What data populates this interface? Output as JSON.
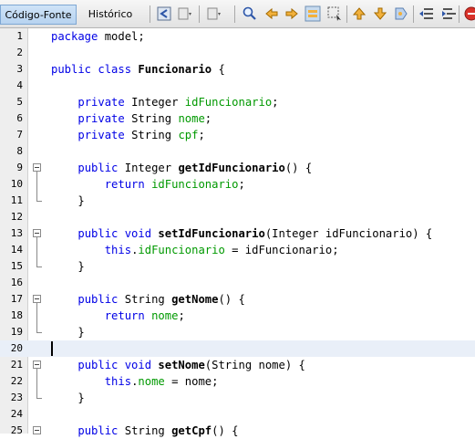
{
  "tabs": [
    {
      "label": "Código-Fonte",
      "active": true
    },
    {
      "label": "Histórico",
      "active": false
    }
  ],
  "toolbar_icons": [
    "back-history-icon",
    "last-edit-icon",
    "forward-edit-icon",
    "search-icon",
    "find-previous-icon",
    "find-next-icon",
    "toggle-highlight-icon",
    "find-selection-icon",
    "prev-bookmark-icon",
    "next-bookmark-icon",
    "toggle-bookmark-icon",
    "shift-left-icon",
    "shift-right-icon",
    "stop-macro-icon"
  ],
  "lines": [
    {
      "n": "1",
      "t": [
        [
          "kw",
          "package"
        ],
        [
          "p",
          " model;"
        ]
      ]
    },
    {
      "n": "2",
      "t": []
    },
    {
      "n": "3",
      "t": [
        [
          "kw",
          "public class"
        ],
        [
          "p",
          " "
        ],
        [
          "cls",
          "Funcionario"
        ],
        [
          "p",
          " {"
        ]
      ]
    },
    {
      "n": "4",
      "t": []
    },
    {
      "n": "5",
      "t": [
        [
          "p",
          "    "
        ],
        [
          "kw",
          "private"
        ],
        [
          "p",
          " Integer "
        ],
        [
          "fld",
          "idFuncionario"
        ],
        [
          "p",
          ";"
        ]
      ]
    },
    {
      "n": "6",
      "t": [
        [
          "p",
          "    "
        ],
        [
          "kw",
          "private"
        ],
        [
          "p",
          " String "
        ],
        [
          "fld",
          "nome"
        ],
        [
          "p",
          ";"
        ]
      ]
    },
    {
      "n": "7",
      "t": [
        [
          "p",
          "    "
        ],
        [
          "kw",
          "private"
        ],
        [
          "p",
          " String "
        ],
        [
          "fld",
          "cpf"
        ],
        [
          "p",
          ";"
        ]
      ]
    },
    {
      "n": "8",
      "t": []
    },
    {
      "n": "9",
      "t": [
        [
          "p",
          "    "
        ],
        [
          "kw",
          "public"
        ],
        [
          "p",
          " Integer "
        ],
        [
          "cls",
          "getIdFuncionario"
        ],
        [
          "p",
          "() {"
        ]
      ]
    },
    {
      "n": "10",
      "t": [
        [
          "p",
          "        "
        ],
        [
          "kw",
          "return"
        ],
        [
          "p",
          " "
        ],
        [
          "fld",
          "idFuncionario"
        ],
        [
          "p",
          ";"
        ]
      ]
    },
    {
      "n": "11",
      "t": [
        [
          "p",
          "    }"
        ]
      ]
    },
    {
      "n": "12",
      "t": []
    },
    {
      "n": "13",
      "t": [
        [
          "p",
          "    "
        ],
        [
          "kw",
          "public void"
        ],
        [
          "p",
          " "
        ],
        [
          "cls",
          "setIdFuncionario"
        ],
        [
          "p",
          "(Integer idFuncionario) {"
        ]
      ]
    },
    {
      "n": "14",
      "t": [
        [
          "p",
          "        "
        ],
        [
          "kw",
          "this"
        ],
        [
          "p",
          "."
        ],
        [
          "fld",
          "idFuncionario"
        ],
        [
          "p",
          " = idFuncionario;"
        ]
      ]
    },
    {
      "n": "15",
      "t": [
        [
          "p",
          "    }"
        ]
      ]
    },
    {
      "n": "16",
      "t": []
    },
    {
      "n": "17",
      "t": [
        [
          "p",
          "    "
        ],
        [
          "kw",
          "public"
        ],
        [
          "p",
          " String "
        ],
        [
          "cls",
          "getNome"
        ],
        [
          "p",
          "() {"
        ]
      ]
    },
    {
      "n": "18",
      "t": [
        [
          "p",
          "        "
        ],
        [
          "kw",
          "return"
        ],
        [
          "p",
          " "
        ],
        [
          "fld",
          "nome"
        ],
        [
          "p",
          ";"
        ]
      ]
    },
    {
      "n": "19",
      "t": [
        [
          "p",
          "    }"
        ]
      ]
    },
    {
      "n": "20",
      "t": []
    },
    {
      "n": "21",
      "t": [
        [
          "p",
          "    "
        ],
        [
          "kw",
          "public void"
        ],
        [
          "p",
          " "
        ],
        [
          "cls",
          "setNome"
        ],
        [
          "p",
          "(String nome) {"
        ]
      ]
    },
    {
      "n": "22",
      "t": [
        [
          "p",
          "        "
        ],
        [
          "kw",
          "this"
        ],
        [
          "p",
          "."
        ],
        [
          "fld",
          "nome"
        ],
        [
          "p",
          " = nome;"
        ]
      ]
    },
    {
      "n": "23",
      "t": [
        [
          "p",
          "    }"
        ]
      ]
    },
    {
      "n": "24",
      "t": []
    },
    {
      "n": "25",
      "t": [
        [
          "p",
          "    "
        ],
        [
          "kw",
          "public"
        ],
        [
          "p",
          " String "
        ],
        [
          "cls",
          "getCpf"
        ],
        [
          "p",
          "() {"
        ]
      ]
    }
  ],
  "current_line": "20",
  "folds": [
    {
      "start": "9",
      "end": "11"
    },
    {
      "start": "13",
      "end": "15"
    },
    {
      "start": "17",
      "end": "19"
    },
    {
      "start": "21",
      "end": "23"
    },
    {
      "start": "25",
      "end": ""
    }
  ]
}
